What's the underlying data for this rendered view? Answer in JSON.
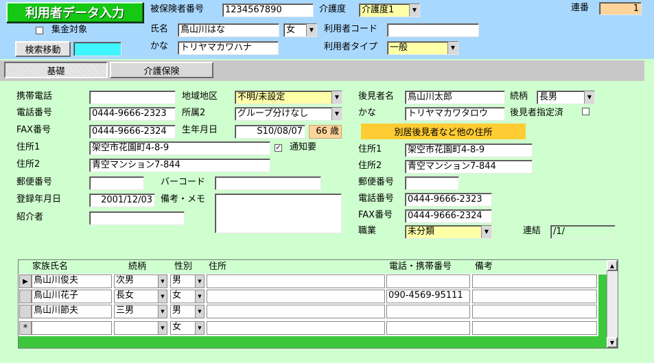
{
  "header": {
    "title": "利用者データ入力",
    "insured_no_label": "被保険者番号",
    "insured_no": "1234567890",
    "care_level_label": "介護度",
    "care_level": "介護度1",
    "serial_label": "連番",
    "serial": "1",
    "subsidy_label": "集金対象",
    "name_label": "氏名",
    "name": "鳥山川はな",
    "sex": "女",
    "user_code_label": "利用者コード",
    "user_code": "",
    "search_button": "検索移動",
    "kana_label": "かな",
    "kana": "トリヤマカワハナ",
    "user_type_label": "利用者タイプ",
    "user_type": "一般"
  },
  "tabs": [
    {
      "label": "基礎",
      "active": true
    },
    {
      "label": "介護保険",
      "active": false
    }
  ],
  "left": {
    "mobile_label": "携帯電話",
    "mobile": "",
    "region_label": "地域地区",
    "region": "不明/未設定",
    "phone_label": "電話番号",
    "phone": "0444-9666-2323",
    "group_label": "所属2",
    "group": "グループ分けなし",
    "fax_label": "FAX番号",
    "fax": "0444-9666-2324",
    "birth_label": "生年月日",
    "birth": "S10/08/07",
    "age": "66 歳",
    "addr1_label": "住所1",
    "addr1": "架空市花園町4-8-9",
    "notify_label": "通知要",
    "notify_checked": "✓",
    "addr2_label": "住所2",
    "addr2": "青空マンション7-844",
    "zip_label": "郵便番号",
    "zip": "",
    "barcode_label": "バーコード",
    "barcode": "",
    "reg_label": "登録年月日",
    "reg": "2001/12/03",
    "memo_label": "備考・メモ",
    "memo": "",
    "intro_label": "紹介者",
    "intro": ""
  },
  "right": {
    "guardian_label": "後見者名",
    "guardian": "鳥山川太郎",
    "relation_label": "続柄",
    "relation": "長男",
    "kana_label": "かな",
    "kana": "トリヤマカワタロウ",
    "designated_label": "後見者指定済",
    "separate_button": "別居後見者など他の住所",
    "addr1_label": "住所1",
    "addr1": "架空市花園町4-8-9",
    "addr2_label": "住所2",
    "addr2": "青空マンション7-844",
    "zip_label": "郵便番号",
    "zip": "",
    "phone_label": "電話番号",
    "phone": "0444-9666-2323",
    "fax_label": "FAX番号",
    "fax": "0444-9666-2324",
    "job_label": "職業",
    "job": "未分類",
    "link_label": "連結",
    "link": "/1/"
  },
  "family": {
    "headers": [
      "家族氏名",
      "続柄",
      "性別",
      "住所",
      "電話・携帯番号",
      "備考"
    ],
    "rows": [
      {
        "marker": "▶",
        "name": "鳥山川俊夫",
        "relation": "次男",
        "sex": "男",
        "address": "",
        "phone": "",
        "note": ""
      },
      {
        "marker": "",
        "name": "鳥山川花子",
        "relation": "長女",
        "sex": "女",
        "address": "",
        "phone": "090-4569-95111",
        "note": ""
      },
      {
        "marker": "",
        "name": "鳥山川節夫",
        "relation": "三男",
        "sex": "男",
        "address": "",
        "phone": "",
        "note": ""
      },
      {
        "marker": "*",
        "name": "",
        "relation": "",
        "sex": "女",
        "address": "",
        "phone": "",
        "note": ""
      }
    ]
  },
  "icons": {
    "dropdown": "▼",
    "scroll_up": "▲",
    "scroll_down": "▼"
  }
}
